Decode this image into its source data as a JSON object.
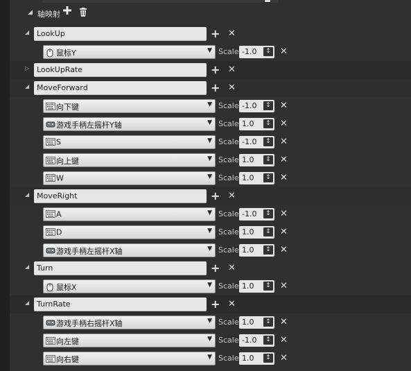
{
  "section": {
    "title": "轴映射"
  },
  "scale_label": "Scale",
  "mappings": [
    {
      "name": "LookUp",
      "expanded": true,
      "keys": [
        {
          "label": "鼠标Y",
          "icon": "mouse-icon",
          "scale": "-1.0"
        }
      ]
    },
    {
      "name": "LookUpRate",
      "expanded": false,
      "keys": []
    },
    {
      "name": "MoveForward",
      "expanded": true,
      "keys": [
        {
          "label": "向下键",
          "icon": "keyboard-icon",
          "scale": "-1.0"
        },
        {
          "label": "游戏手柄左摇杆Y轴",
          "icon": "gamepad-icon",
          "scale": "1.0"
        },
        {
          "label": "S",
          "icon": "keyboard-icon",
          "scale": "-1.0"
        },
        {
          "label": "向上键",
          "icon": "keyboard-icon",
          "scale": "1.0"
        },
        {
          "label": "W",
          "icon": "keyboard-icon",
          "scale": "1.0"
        }
      ]
    },
    {
      "name": "MoveRight",
      "expanded": true,
      "keys": [
        {
          "label": "A",
          "icon": "keyboard-icon",
          "scale": "-1.0"
        },
        {
          "label": "D",
          "icon": "keyboard-icon",
          "scale": "1.0"
        },
        {
          "label": "游戏手柄左摇杆X轴",
          "icon": "gamepad-icon",
          "scale": "1.0"
        }
      ]
    },
    {
      "name": "Turn",
      "expanded": true,
      "keys": [
        {
          "label": "鼠标X",
          "icon": "mouse-icon",
          "scale": "1.0"
        }
      ]
    },
    {
      "name": "TurnRate",
      "expanded": true,
      "keys": [
        {
          "label": "游戏手柄右摇杆X轴",
          "icon": "gamepad-icon",
          "scale": "1.0"
        },
        {
          "label": "向左键",
          "icon": "keyboard-icon",
          "scale": "-1.0"
        },
        {
          "label": "向右键",
          "icon": "keyboard-icon",
          "scale": "1.0"
        }
      ]
    }
  ]
}
